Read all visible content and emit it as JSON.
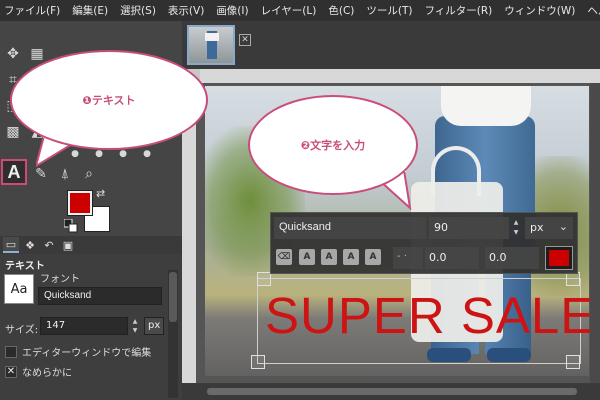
{
  "menubar": {
    "items": [
      "ファイル(F)",
      "編集(E)",
      "選択(S)",
      "表示(V)",
      "画像(I)",
      "レイヤー(L)",
      "色(C)",
      "ツール(T)",
      "フィルター(R)",
      "ウィンドウ(W)",
      "ヘルプ(H)"
    ]
  },
  "toolbox": {
    "text_tool_glyph": "A",
    "fg_color": "#cc0000",
    "bg_color": "#ffffff"
  },
  "tool_options": {
    "title": "テキスト",
    "font_label": "フォント",
    "font_preview": "Aa",
    "font_value": "Quicksand",
    "size_label": "サイズ:",
    "size_value": "147",
    "size_unit": "px",
    "editor_checkbox_label": "エディターウィンドウで編集",
    "antialias_label": "なめらかに",
    "antialias_checked": "✕"
  },
  "canvas": {
    "text_content": "SUPER SALE",
    "text_color": "#cc1414",
    "on_canvas_toolbar": {
      "font": "Quicksand",
      "size": "90",
      "unit": "px",
      "baseline": "0.0",
      "kerning": "0.0",
      "color": "#cc0000"
    }
  },
  "callouts": [
    {
      "text": "❶テキスト"
    },
    {
      "text": "❷文字を入力"
    }
  ],
  "accent_color": "#c94d7c"
}
